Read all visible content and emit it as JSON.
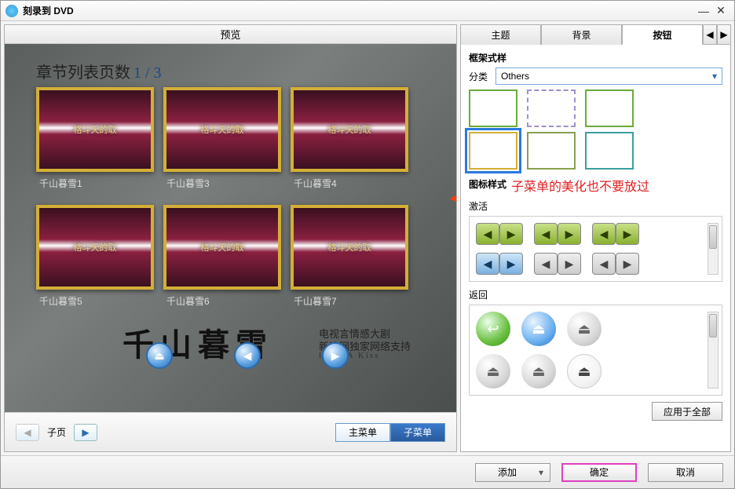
{
  "window": {
    "title": "刻录到 DVD"
  },
  "left": {
    "tab_preview": "预览",
    "chapter_heading": "章节列表页数",
    "page_indicator": "1 / 3",
    "thumbs": [
      {
        "label": "千山暮雪1",
        "overlay": "格斗天的取"
      },
      {
        "label": "千山暮雪3",
        "overlay": "格斗天的取"
      },
      {
        "label": "千山暮雪4",
        "overlay": "格斗天的取"
      },
      {
        "label": "千山暮雪5",
        "overlay": "格斗天的取"
      },
      {
        "label": "千山暮雪6",
        "overlay": "格斗天的取"
      },
      {
        "label": "千山暮雪7",
        "overlay": "格斗天的取"
      }
    ],
    "brand_main": "千山暮雪",
    "brand_sub1": "电视言情感大剧",
    "brand_sub2": "新浪网独家网络支持",
    "brand_sub3": "led    n  A  Kiss",
    "subpage_label": "子页",
    "seg_main": "主菜单",
    "seg_sub": "子菜单"
  },
  "right": {
    "tab_theme": "主题",
    "tab_background": "背景",
    "tab_button": "按钮",
    "frame_style_label": "框架式样",
    "category_label": "分类",
    "category_value": "Others",
    "icon_style_label": "图标样式",
    "annotation_text": "子菜单的美化也不要放过",
    "activate_label": "激活",
    "return_label": "返回",
    "apply_all": "应用于全部"
  },
  "footer": {
    "add": "添加",
    "ok": "确定",
    "cancel": "取消"
  }
}
